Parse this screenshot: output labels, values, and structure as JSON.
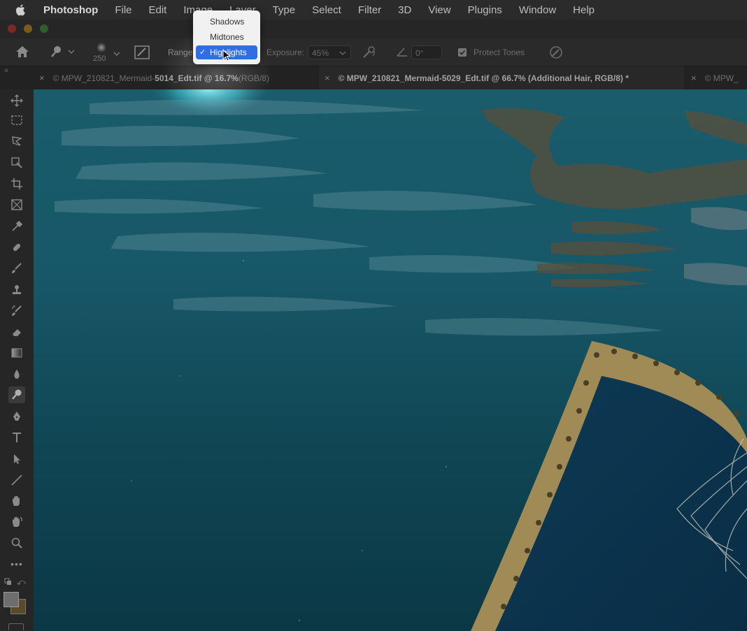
{
  "menubar": {
    "app_name": "Photoshop",
    "items": [
      "File",
      "Edit",
      "Image",
      "Layer",
      "Type",
      "Select",
      "Filter",
      "3D",
      "View",
      "Plugins",
      "Window",
      "Help"
    ]
  },
  "options_bar": {
    "brush_size": "250",
    "range_label": "Range:",
    "range_value": "Highlights",
    "exposure_label": "Exposure:",
    "exposure_value": "45%",
    "angle_value": "0°",
    "protect_tones_label": "Protect Tones",
    "protect_tones_checked": true
  },
  "range_menu": {
    "options": [
      "Shadows",
      "Midtones",
      "Highlights"
    ],
    "selected": "Highlights"
  },
  "tabs": [
    {
      "prefix": "© MPW_210821_Mermaid-",
      "bold": "5014_Edt.tif @ 16.7%",
      "suffix": " (RGB/8)",
      "active": false
    },
    {
      "prefix": "© MPW_210821_Mermaid-5029_Edt.tif @ 66.7% (Additional Hair, RGB/8) *",
      "bold": "",
      "suffix": "",
      "active": true
    },
    {
      "prefix": "© MPW_",
      "bold": "",
      "suffix": "",
      "active": false
    }
  ],
  "toolbar": {
    "tools": [
      "move-tool",
      "marquee-tool",
      "lasso-tool",
      "object-select-tool",
      "crop-tool",
      "frame-tool",
      "eyedropper-tool",
      "healing-brush-tool",
      "brush-tool",
      "clone-stamp-tool",
      "history-brush-tool",
      "eraser-tool",
      "gradient-tool",
      "blur-tool",
      "dodge-tool",
      "pen-tool",
      "type-tool",
      "path-select-tool",
      "line-tool",
      "hand-tool",
      "rotate-view-tool",
      "zoom-tool",
      "more-tools"
    ],
    "active_tool": "dodge-tool",
    "foreground_color": "#6e6e6e",
    "background_color": "#5a4a2a"
  },
  "colors": {
    "accent": "#2f6fe3",
    "water_dark": "#0c3a47",
    "water_mid": "#165a6a",
    "frame_gold": "#8b7a4a"
  }
}
